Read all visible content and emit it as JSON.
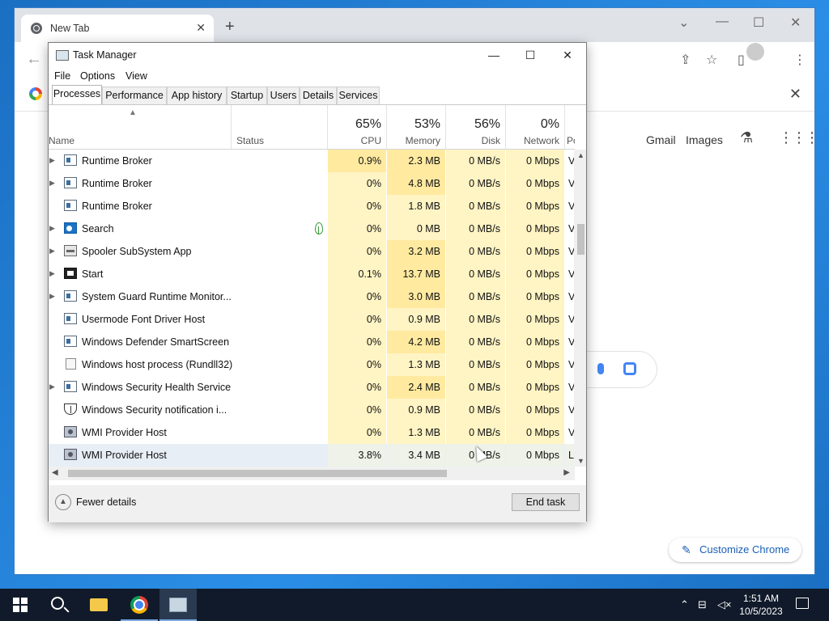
{
  "chrome": {
    "tab_title": "New Tab",
    "tab_close": "✕",
    "new_tab": "+",
    "window_controls": [
      "⌄",
      "—",
      "☐",
      "✕"
    ],
    "back": "←",
    "toolbar_icons": [
      "share-icon",
      "star-icon",
      "sidepanel-icon",
      "menu-icon"
    ],
    "infobar_close": "✕",
    "gmail": "Gmail",
    "images": "Images",
    "customize": "Customize Chrome"
  },
  "task_manager": {
    "title": "Task Manager",
    "window_controls": [
      "—",
      "☐",
      "✕"
    ],
    "menu": [
      "File",
      "Options",
      "View"
    ],
    "tabs": [
      "Processes",
      "Performance",
      "App history",
      "Startup",
      "Users",
      "Details",
      "Services"
    ],
    "active_tab": "Processes",
    "columns": {
      "name": "Name",
      "status": "Status",
      "cpu": {
        "pct": "65%",
        "label": "CPU"
      },
      "memory": {
        "pct": "53%",
        "label": "Memory"
      },
      "disk": {
        "pct": "56%",
        "label": "Disk"
      },
      "network": {
        "pct": "0%",
        "label": "Network"
      },
      "power": "Pov"
    },
    "rows": [
      {
        "expand": true,
        "icon": "window",
        "name": "Runtime Broker",
        "cpu": "0.9%",
        "mem": "2.3 MB",
        "disk": "0 MB/s",
        "net": "0 Mbps",
        "pow": "V"
      },
      {
        "expand": true,
        "icon": "window",
        "name": "Runtime Broker",
        "cpu": "0%",
        "mem": "4.8 MB",
        "disk": "0 MB/s",
        "net": "0 Mbps",
        "pow": "V"
      },
      {
        "expand": false,
        "icon": "window",
        "name": "Runtime Broker",
        "cpu": "0%",
        "mem": "1.8 MB",
        "disk": "0 MB/s",
        "net": "0 Mbps",
        "pow": "V"
      },
      {
        "expand": true,
        "icon": "search",
        "name": "Search",
        "cpu": "0%",
        "mem": "0 MB",
        "disk": "0 MB/s",
        "net": "0 Mbps",
        "pow": "V",
        "suspended": true
      },
      {
        "expand": true,
        "icon": "printer",
        "name": "Spooler SubSystem App",
        "cpu": "0%",
        "mem": "3.2 MB",
        "disk": "0 MB/s",
        "net": "0 Mbps",
        "pow": "V"
      },
      {
        "expand": true,
        "icon": "start",
        "name": "Start",
        "cpu": "0.1%",
        "mem": "13.7 MB",
        "disk": "0 MB/s",
        "net": "0 Mbps",
        "pow": "V"
      },
      {
        "expand": true,
        "icon": "window",
        "name": "System Guard Runtime Monitor...",
        "cpu": "0%",
        "mem": "3.0 MB",
        "disk": "0 MB/s",
        "net": "0 Mbps",
        "pow": "V"
      },
      {
        "expand": false,
        "icon": "window",
        "name": "Usermode Font Driver Host",
        "cpu": "0%",
        "mem": "0.9 MB",
        "disk": "0 MB/s",
        "net": "0 Mbps",
        "pow": "V"
      },
      {
        "expand": false,
        "icon": "window",
        "name": "Windows Defender SmartScreen",
        "cpu": "0%",
        "mem": "4.2 MB",
        "disk": "0 MB/s",
        "net": "0 Mbps",
        "pow": "V"
      },
      {
        "expand": false,
        "icon": "doc",
        "name": "Windows host process (Rundll32)",
        "cpu": "0%",
        "mem": "1.3 MB",
        "disk": "0 MB/s",
        "net": "0 Mbps",
        "pow": "V"
      },
      {
        "expand": true,
        "icon": "window",
        "name": "Windows Security Health Service",
        "cpu": "0%",
        "mem": "2.4 MB",
        "disk": "0 MB/s",
        "net": "0 Mbps",
        "pow": "V"
      },
      {
        "expand": false,
        "icon": "shield",
        "name": "Windows Security notification i...",
        "cpu": "0%",
        "mem": "0.9 MB",
        "disk": "0 MB/s",
        "net": "0 Mbps",
        "pow": "V"
      },
      {
        "expand": false,
        "icon": "gear",
        "name": "WMI Provider Host",
        "cpu": "0%",
        "mem": "1.3 MB",
        "disk": "0 MB/s",
        "net": "0 Mbps",
        "pow": "V"
      },
      {
        "expand": false,
        "icon": "gear",
        "name": "WMI Provider Host",
        "cpu": "3.8%",
        "mem": "3.4 MB",
        "disk": "0 MB/s",
        "net": "0 Mbps",
        "pow": "L",
        "selected": true
      }
    ],
    "fewer_details": "Fewer details",
    "end_task": "End task"
  },
  "taskbar": {
    "apps": [
      "start-icon",
      "search-icon",
      "file-explorer-icon",
      "chrome-icon",
      "task-manager-icon"
    ],
    "time": "1:51 AM",
    "date": "10/5/2023"
  }
}
